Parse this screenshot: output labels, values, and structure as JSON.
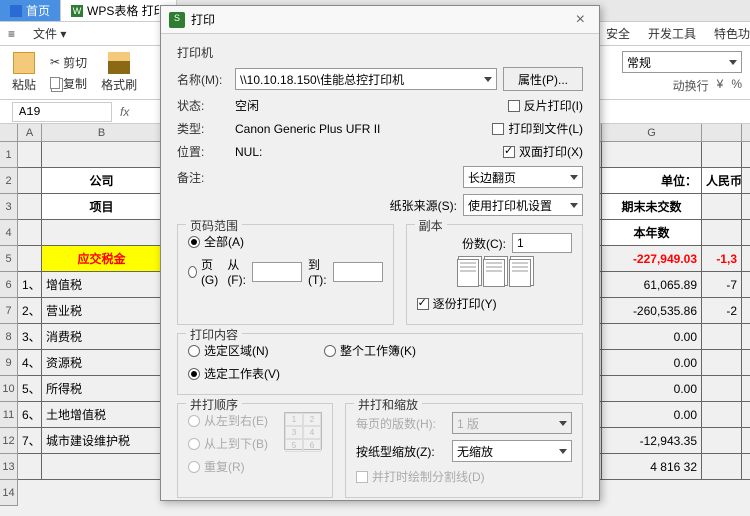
{
  "tabs": {
    "home": "首页",
    "doc": "WPS表格 打印"
  },
  "ribbon_tabs": {
    "file": "文件",
    "sec": "安全",
    "dev": "开发工具",
    "spec": "特色功"
  },
  "ribbon": {
    "paste": "粘贴",
    "cut": "剪切",
    "copy": "复制",
    "format": "格式刷",
    "normal": "常规",
    "wrap": "动换行",
    "currency": "¥",
    "percent": "%"
  },
  "namebox": {
    "value": "A19"
  },
  "sheet": {
    "cols": [
      "A",
      "B",
      "",
      "",
      "",
      "",
      "G",
      ""
    ],
    "row_start": 1,
    "title_left": "公司",
    "unit": "单位：",
    "unit_val": "人民币",
    "header_item": "项目",
    "header_right": "期末未交数",
    "header_year": "本年数",
    "tax_total_label": "应交税金",
    "tax_total_val": "-227,949.03",
    "tax_total_r": "-1,3",
    "rows": [
      {
        "n": "1、",
        "name": "增值税",
        "v": "61,065.89",
        "r": "-7"
      },
      {
        "n": "2、",
        "name": "营业税",
        "v": "-260,535.86",
        "r": "-2"
      },
      {
        "n": "3、",
        "name": "消费税",
        "v": "0.00",
        "r": ""
      },
      {
        "n": "4、",
        "name": "资源税",
        "v": "0.00",
        "r": ""
      },
      {
        "n": "5、",
        "name": "所得税",
        "v": "0.00",
        "r": ""
      },
      {
        "n": "6、",
        "name": "土地增值税",
        "v": "0.00",
        "r": ""
      },
      {
        "n": "7、",
        "name": "城市建设维护税",
        "v": "-12,943.35",
        "r": ""
      },
      {
        "n": "",
        "name": "",
        "v": "4 816 32",
        "r": ""
      }
    ]
  },
  "dlg": {
    "title": "打印",
    "printer": "打印机",
    "name_lbl": "名称(M):",
    "name_val": "\\\\10.10.18.150\\佳能总控打印机",
    "props": "属性(P)...",
    "status_lbl": "状态:",
    "status_val": "空闲",
    "type_lbl": "类型:",
    "type_val": "Canon Generic Plus UFR II",
    "where_lbl": "位置:",
    "where_val": "NUL:",
    "comment_lbl": "备注:",
    "reverse": "反片打印(I)",
    "tofile": "打印到文件(L)",
    "duplex": "双面打印(X)",
    "flip": "长边翻页",
    "source_lbl": "纸张来源(S):",
    "source_val": "使用打印机设置",
    "range": "页码范围",
    "all": "全部(A)",
    "pages": "页(G)",
    "from": "从(F):",
    "to": "到(T):",
    "copies": "副本",
    "copies_lbl": "份数(C):",
    "copies_val": "1",
    "collate": "逐份打印(Y)",
    "content": "打印内容",
    "sel": "选定区域(N)",
    "wb": "整个工作簿(K)",
    "sheet_opt": "选定工作表(V)",
    "order": "并打顺序",
    "lr": "从左到右(E)",
    "tb": "从上到下(B)",
    "rep": "重复(R)",
    "scale": "并打和缩放",
    "ppp_lbl": "每页的版数(H):",
    "ppp_val": "1 版",
    "zoom_lbl": "按纸型缩放(Z):",
    "zoom_val": "无缩放",
    "drawline": "并打时绘制分割线(D)"
  }
}
